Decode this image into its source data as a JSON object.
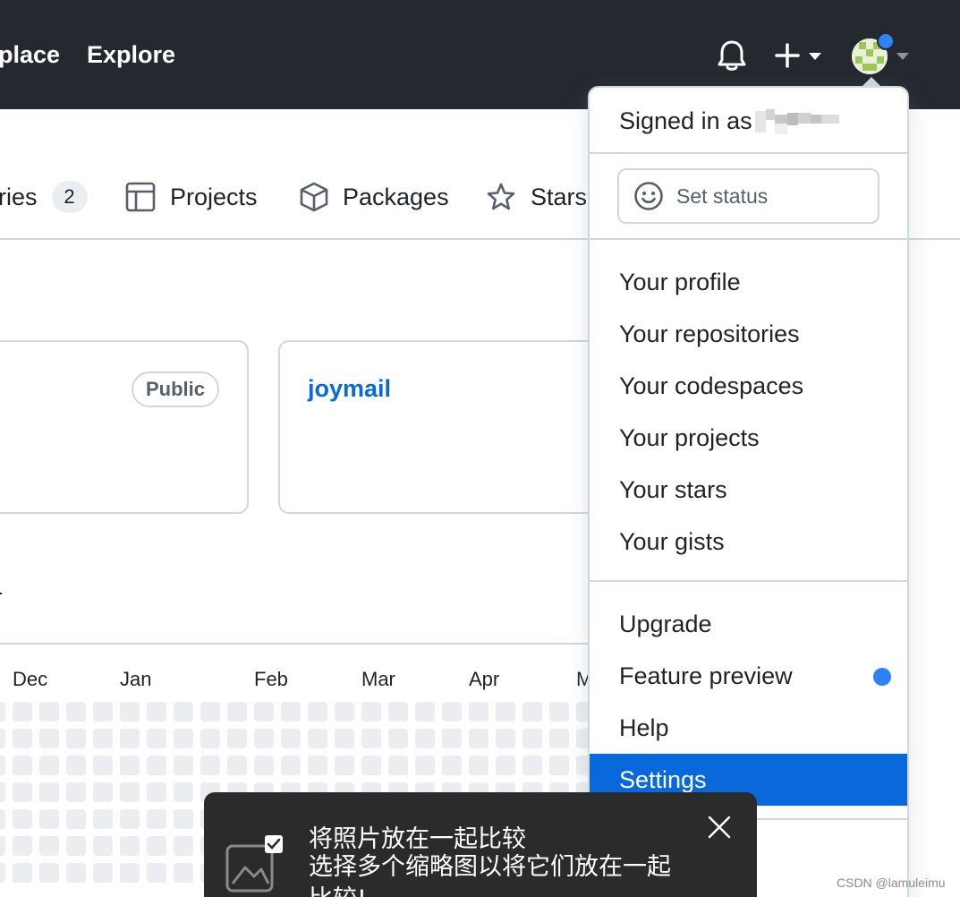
{
  "header": {
    "nav": [
      "place",
      "Explore"
    ]
  },
  "tabs": [
    {
      "label": "ries",
      "count": "2"
    },
    {
      "label": "Projects"
    },
    {
      "label": "Packages"
    },
    {
      "label": "Stars"
    }
  ],
  "pinned": {
    "badge": "Public",
    "repo": "joymail"
  },
  "contributions": {
    "months": [
      "Dec",
      "Jan",
      "Feb",
      "Mar",
      "Apr",
      "M"
    ]
  },
  "dropdown": {
    "signed_in_label": "Signed in as",
    "status_placeholder": "Set status",
    "group1": [
      "Your profile",
      "Your repositories",
      "Your codespaces",
      "Your projects",
      "Your stars",
      "Your gists"
    ],
    "group2": [
      "Upgrade",
      "Feature preview",
      "Help",
      "Settings"
    ],
    "active_item": "Settings"
  },
  "toast": {
    "title": "将照片放在一起比较",
    "body": "选择多个缩略图以将它们放在一起比较!"
  },
  "watermark": "CSDN @lamuleimu",
  "colors": {
    "header_bg": "#24292f",
    "accent": "#0969da",
    "notification_dot": "#2f81f7"
  }
}
